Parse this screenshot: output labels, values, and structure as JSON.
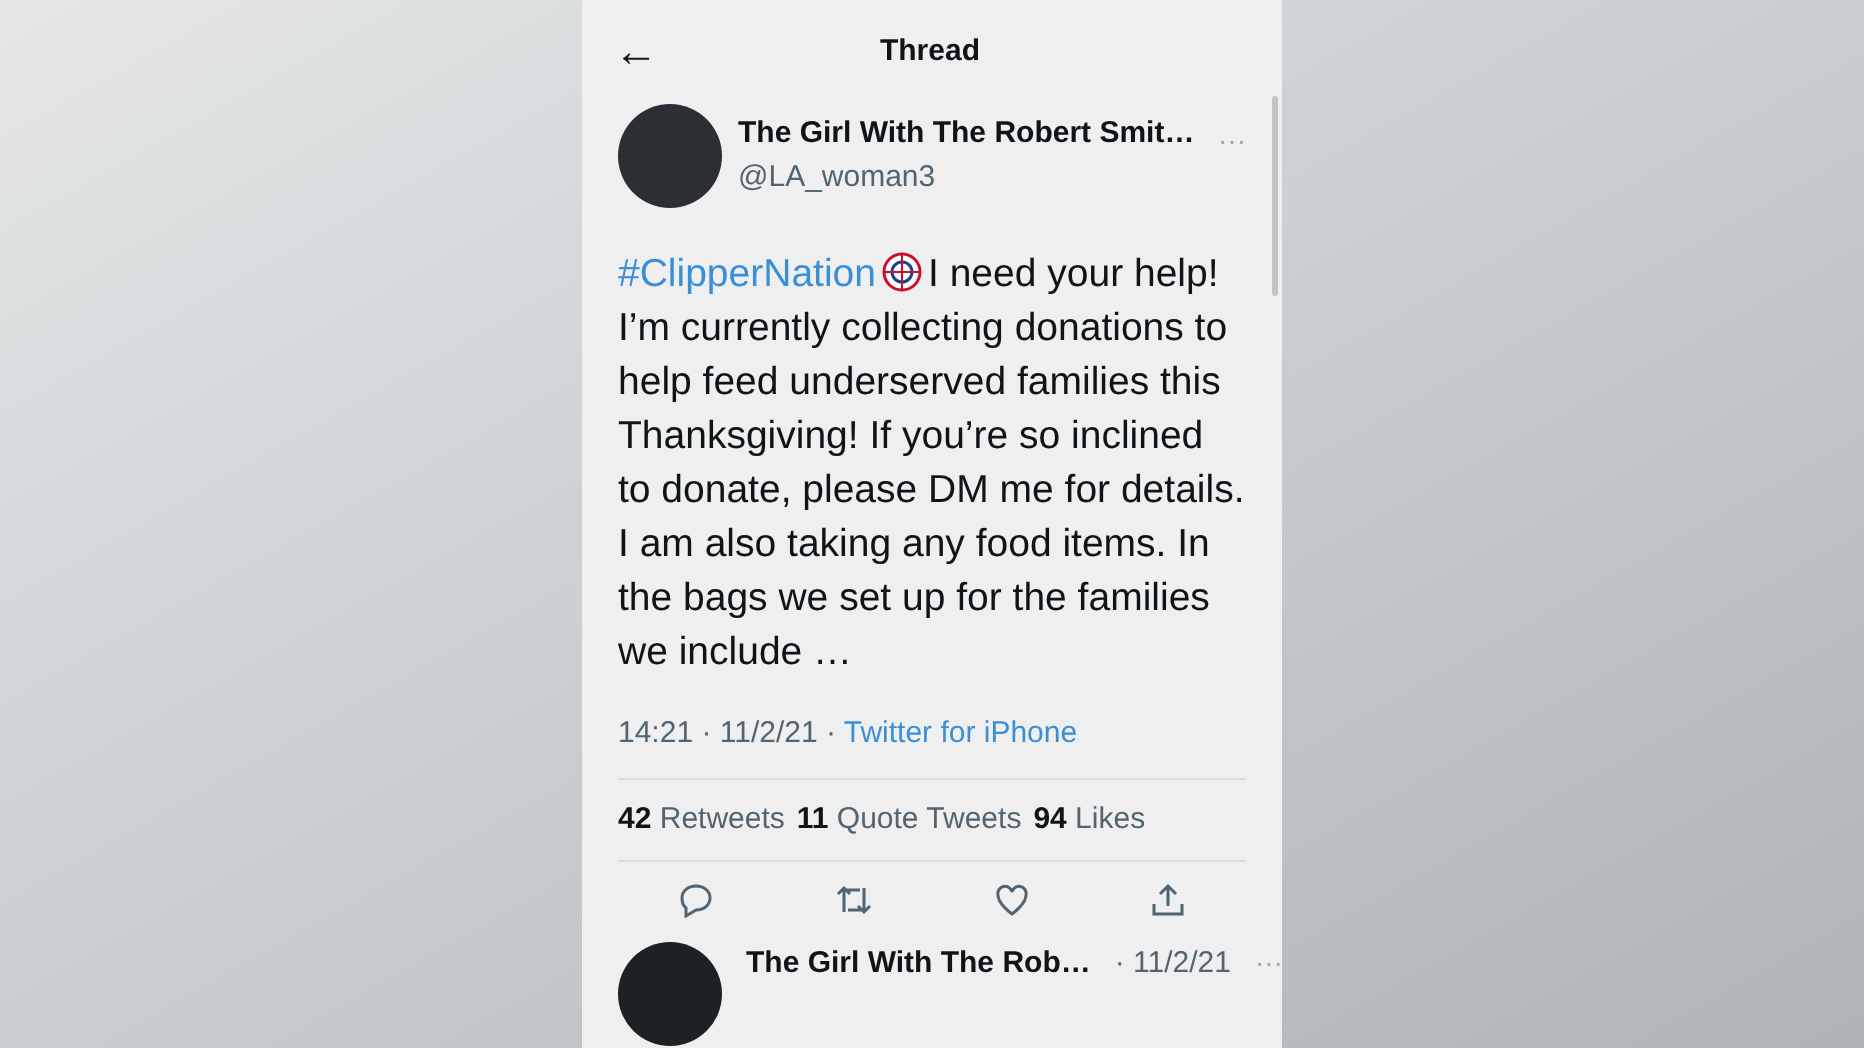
{
  "header": {
    "back": "←",
    "title": "Thread"
  },
  "tweet": {
    "name": "The Girl With The Robert Smit…",
    "handle": "@LA_woman3",
    "more": "···",
    "hashtag": "#ClipperNation",
    "text": "I need your help! I’m currently collecting donations to help feed underserved families this Thanksgiving! If you’re so inclined to donate, please DM me for details. I am also taking any food items. In the bags we set up for the families we include …",
    "time": "14:21 · 11/2/21 · ",
    "source": "Twitter for iPhone",
    "stats": [
      "**42** Retweets",
      "**11** Quote Tweets",
      "**94** Likes"
    ]
  },
  "reply": {
    "name": "The Girl With The Rob…",
    "date": "· 11/2/21",
    "more": "···"
  }
}
